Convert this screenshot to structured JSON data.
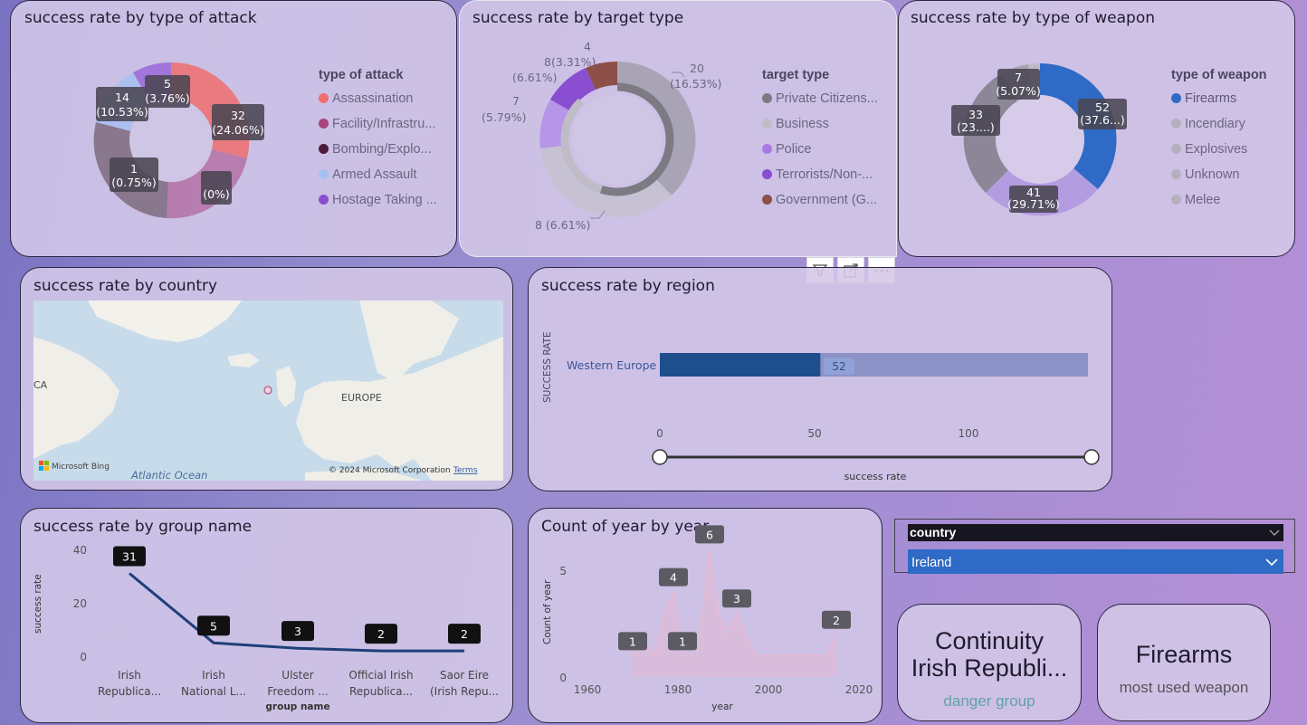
{
  "colors": {
    "accent_blue": "#2f6ac6",
    "dark_blue": "#1f4e8c",
    "danger_teal": "#5fa3a6"
  },
  "attack": {
    "title": "success rate by type of attack",
    "legend_title": "type of attack",
    "legend": [
      "Assassination",
      "Facility/Infrastru...",
      "Bombing/Explo...",
      "Armed Assault",
      "Hostage Taking ..."
    ],
    "labels": [
      {
        "l1": "5",
        "l2": "(3.76%)"
      },
      {
        "l1": "14",
        "l2": "(10.53%)"
      },
      {
        "l1": "32",
        "l2": "(24.06%)"
      },
      {
        "l1": "1",
        "l2": "(0.75%)"
      },
      {
        "l1": "",
        "l2": "(0%)"
      }
    ]
  },
  "target": {
    "title": "success rate by target type",
    "legend_title": "target type",
    "legend": [
      "Private Citizens...",
      "Business",
      "Police",
      "Terrorists/Non-...",
      "Government (G..."
    ],
    "labels": [
      "4",
      "8(3.31%)",
      "(6.61%)",
      "7",
      "(5.79%)",
      "20",
      "(16.53%)",
      "8 (6.61%)"
    ]
  },
  "weapon": {
    "title": "success rate by type of weapon",
    "legend_title": "type of weapon",
    "legend": [
      "Firearms",
      "Incendiary",
      "Explosives",
      "Unknown",
      "Melee"
    ],
    "labels": [
      {
        "l1": "7",
        "l2": "(5.07%)"
      },
      {
        "l1": "33",
        "l2": "(23....)"
      },
      {
        "l1": "52",
        "l2": "(37.6...)"
      },
      {
        "l1": "41",
        "l2": "(29.71%)"
      }
    ]
  },
  "country": {
    "title": "success rate by country",
    "map_labels": {
      "europe": "EUROPE",
      "atlantic": "Atlantic Ocean",
      "ca": "CA",
      "bing": "Microsoft Bing",
      "copyright": "© 2024 Microsoft Corporation",
      "terms": "Terms"
    }
  },
  "region": {
    "title": "success rate by region",
    "ylabel": "SUCCESS RATE",
    "xlabel": "success rate",
    "category": "Western Europe",
    "value_label": "52",
    "ticks": [
      "0",
      "50",
      "100"
    ]
  },
  "group": {
    "title": "success rate by group name",
    "ylabel": "success rate",
    "xlabel": "group name",
    "yticks": [
      "40",
      "20",
      "0"
    ],
    "names": [
      {
        "l1": "Irish",
        "l2": "Republica..."
      },
      {
        "l1": "Irish",
        "l2": "National L..."
      },
      {
        "l1": "Ulster",
        "l2": "Freedom ..."
      },
      {
        "l1": "Official Irish",
        "l2": "Republica..."
      },
      {
        "l1": "Saor Eire",
        "l2": "(Irish Repu..."
      }
    ]
  },
  "yearchart": {
    "title": "Count of year by year",
    "ylabel": "Count of year",
    "xlabel": "year",
    "xticks": [
      "1960",
      "1980",
      "2000",
      "2020"
    ],
    "yticks": [
      "5",
      "0"
    ]
  },
  "slicer": {
    "header": "country",
    "value": "Ireland"
  },
  "kpi1": {
    "line1": "Continuity",
    "line2": "Irish Republi...",
    "sub": "danger group"
  },
  "kpi2": {
    "value": "Firearms",
    "sub": "most used weapon"
  },
  "chart_data": [
    {
      "type": "pie",
      "title": "success rate by type of attack",
      "legend_title": "type of attack",
      "categories": [
        "Assassination",
        "Facility/Infrastru...",
        "Bombing/Explo...",
        "Armed Assault",
        "Hostage Taking ..."
      ],
      "data_labels": [
        "32 (24.06%)",
        "(0%)",
        "1 (0.75%)",
        "14 (10.53%)",
        "5 (3.76%)"
      ]
    },
    {
      "type": "pie",
      "title": "success rate by target type",
      "legend_title": "target type",
      "categories": [
        "Private Citizens...",
        "Business",
        "Police",
        "Terrorists/Non-...",
        "Government (G..."
      ],
      "data_labels": [
        "20 (16.53%)",
        "8 (6.61%)",
        "7 (5.79%)",
        "8 (6.61%)",
        "4 (3.31%)"
      ]
    },
    {
      "type": "pie",
      "title": "success rate by type of weapon",
      "legend_title": "type of weapon",
      "categories": [
        "Firearms",
        "Incendiary",
        "Explosives",
        "Unknown",
        "Melee"
      ],
      "values": [
        52,
        41,
        33,
        7
      ],
      "data_labels": [
        "52 (37.6...)",
        "41 (29.71%)",
        "33 (23....)",
        "7 (5.07%)"
      ]
    },
    {
      "type": "bar",
      "title": "success rate by region",
      "categories": [
        "Western Europe"
      ],
      "values": [
        52
      ],
      "xlim": [
        0,
        130
      ],
      "xlabel": "success rate",
      "ylabel": "SUCCESS RATE"
    },
    {
      "type": "line",
      "title": "success rate by group name",
      "categories": [
        "Irish Republica...",
        "Irish National L...",
        "Ulster Freedom ...",
        "Official Irish Republica...",
        "Saor Eire (Irish Repu..."
      ],
      "values": [
        31,
        5,
        3,
        2,
        2
      ],
      "ylim": [
        0,
        40
      ],
      "xlabel": "group name",
      "ylabel": "success rate"
    },
    {
      "type": "area",
      "title": "Count of year by year",
      "x": [
        1970,
        1972,
        1975,
        1977,
        1979,
        1981,
        1983,
        1985,
        1987,
        1989,
        1991,
        1993,
        1995,
        1997,
        1999,
        2001,
        2003,
        2005,
        2007,
        2009,
        2011,
        2013,
        2015
      ],
      "values": [
        1,
        2,
        1,
        3,
        4,
        1,
        1,
        2,
        6,
        3,
        2,
        3,
        2,
        1,
        1,
        1,
        1,
        1,
        1,
        1,
        1,
        1,
        2
      ],
      "data_labels": [
        {
          "x": 1970,
          "y": 1
        },
        {
          "x": 1979,
          "y": 4
        },
        {
          "x": 1981,
          "y": 1
        },
        {
          "x": 1987,
          "y": 6
        },
        {
          "x": 1993,
          "y": 3
        },
        {
          "x": 2015,
          "y": 2
        }
      ],
      "xlim": [
        1960,
        2020
      ],
      "ylim": [
        0,
        7
      ],
      "xlabel": "year",
      "ylabel": "Count of year"
    }
  ]
}
